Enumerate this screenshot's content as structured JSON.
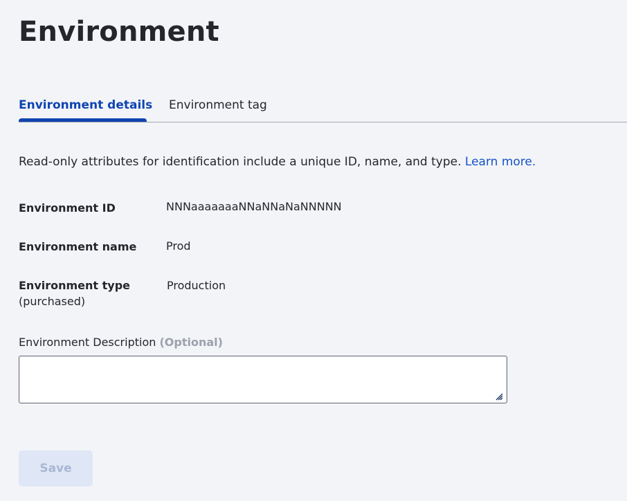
{
  "page": {
    "title": "Environment"
  },
  "tabs": [
    {
      "label": "Environment details",
      "active": true
    },
    {
      "label": "Environment tag",
      "active": false
    }
  ],
  "intro": {
    "text": "Read-only attributes for identification include a unique ID, name, and type. ",
    "link_label": "Learn more."
  },
  "fields": {
    "id": {
      "label": "Environment ID",
      "value": "NNNaaaaaaaNNaNNaNaNNNNN"
    },
    "name": {
      "label": "Environment name",
      "value": "Prod"
    },
    "type": {
      "label": "Environment type",
      "sublabel": "(purchased)",
      "value": "Production"
    }
  },
  "description": {
    "label": "Environment Description",
    "optional_label": "(Optional)",
    "value": ""
  },
  "actions": {
    "save_label": "Save",
    "save_disabled": true
  },
  "colors": {
    "accent": "#0f45b0",
    "link": "#1452c6",
    "background": "#f3f4f8",
    "disabled_button_bg": "#dfe6f5",
    "disabled_button_text": "#a9b7d4",
    "optional_text": "#9ba1ad"
  },
  "icons": {
    "resize_handle": "resize-handle-icon"
  }
}
